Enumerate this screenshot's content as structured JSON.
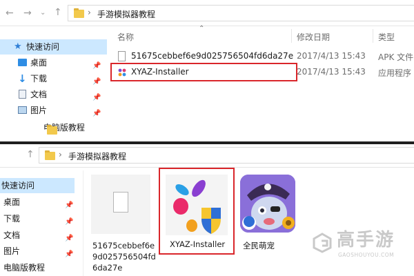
{
  "top": {
    "breadcrumb_sep": "›",
    "breadcrumb": "手游模拟器教程",
    "columns": {
      "name": "名称",
      "date": "修改日期",
      "type": "类型"
    },
    "sidebar": [
      {
        "label": "快速访问"
      },
      {
        "label": "桌面"
      },
      {
        "label": "下载"
      },
      {
        "label": "文档"
      },
      {
        "label": "图片"
      },
      {
        "label": "电脑版教程"
      }
    ],
    "files": [
      {
        "name": "51675cebbef6e9d025756504fd6da27e",
        "date": "2017/4/13 15:43",
        "type": "APK 文件"
      },
      {
        "name": "XYAZ-Installer",
        "date": "2017/4/13 15:43",
        "type": "应用程序"
      }
    ]
  },
  "bottom": {
    "breadcrumb_sep": "›",
    "breadcrumb": "手游模拟器教程",
    "sidebar": [
      {
        "label": "快速访问"
      },
      {
        "label": "桌面"
      },
      {
        "label": "下载"
      },
      {
        "label": "文档"
      },
      {
        "label": "图片"
      },
      {
        "label": "电脑版教程"
      }
    ],
    "tiles": [
      {
        "label_lines": [
          "51675cebbef6e",
          "9d025756504fd",
          "6da27e"
        ]
      },
      {
        "label": "XYAZ-Installer"
      },
      {
        "label": "全民萌宠"
      }
    ]
  },
  "watermark": {
    "text": "高手游",
    "sub": "GAOSHOUYOU.COM"
  },
  "colors": {
    "accent_red": "#d9252a",
    "selection": "#cce8ff",
    "folder": "#f2c94c"
  }
}
